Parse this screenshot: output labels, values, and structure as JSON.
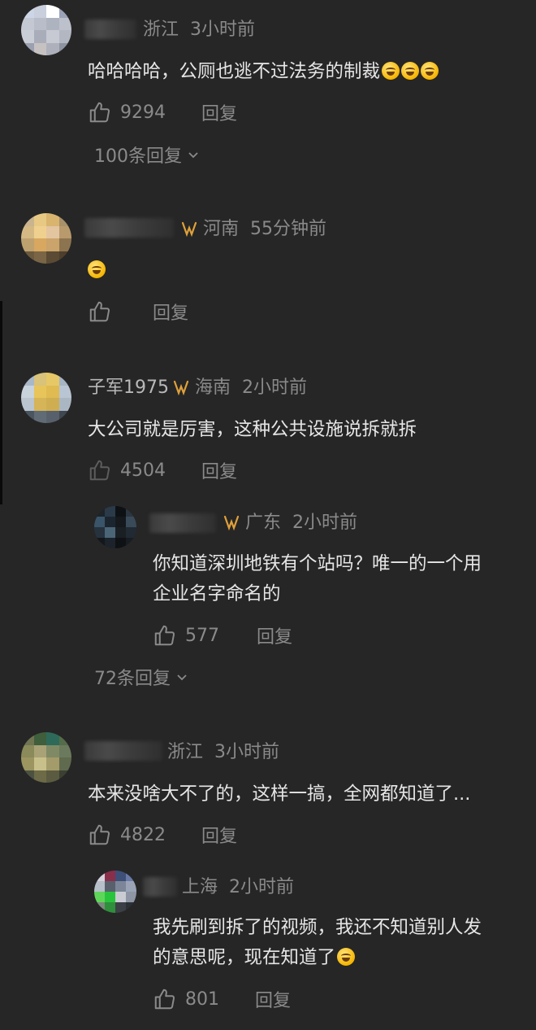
{
  "comments": [
    {
      "location": "浙江",
      "time": "3小时前",
      "text": "哈哈哈哈，公厕也逃不过法务的制裁",
      "likes": "9294",
      "reply_label": "回复",
      "more_replies": "100条回复"
    },
    {
      "location": "河南",
      "time": "55分钟前",
      "reply_label": "回复"
    },
    {
      "username": "子军1975",
      "location": "海南",
      "time": "2小时前",
      "text": "大公司就是厉害，这种公共设施说拆就拆",
      "likes": "4504",
      "reply_label": "回复",
      "reply": {
        "location": "广东",
        "time": "2小时前",
        "text_line1": "你知道深圳地铁有个站吗？唯一的一个用",
        "text_line2": "企业名字命名的",
        "likes": "577",
        "reply_label": "回复"
      },
      "more_replies": "72条回复"
    },
    {
      "location": "浙江",
      "time": "3小时前",
      "text": "本来没啥大不了的，这样一搞，全网都知道了...",
      "likes": "4822",
      "reply_label": "回复",
      "reply": {
        "location": "上海",
        "time": "2小时前",
        "text_line1": "我先刷到拆了的视频，我还不知道别人发",
        "text_line2": "的意思呢，现在知道了",
        "likes": "801",
        "reply_label": "回复"
      }
    }
  ],
  "colors": {
    "background": "#262626",
    "text": "#e6e6e6",
    "meta": "#8a8a8a",
    "badge": "#e0a13a"
  },
  "icons": {
    "like": "thumbs-up-icon",
    "expand": "chevron-down-icon",
    "badge": "creator-badge-icon",
    "emoji": "laughing-crying-emoji-icon"
  }
}
